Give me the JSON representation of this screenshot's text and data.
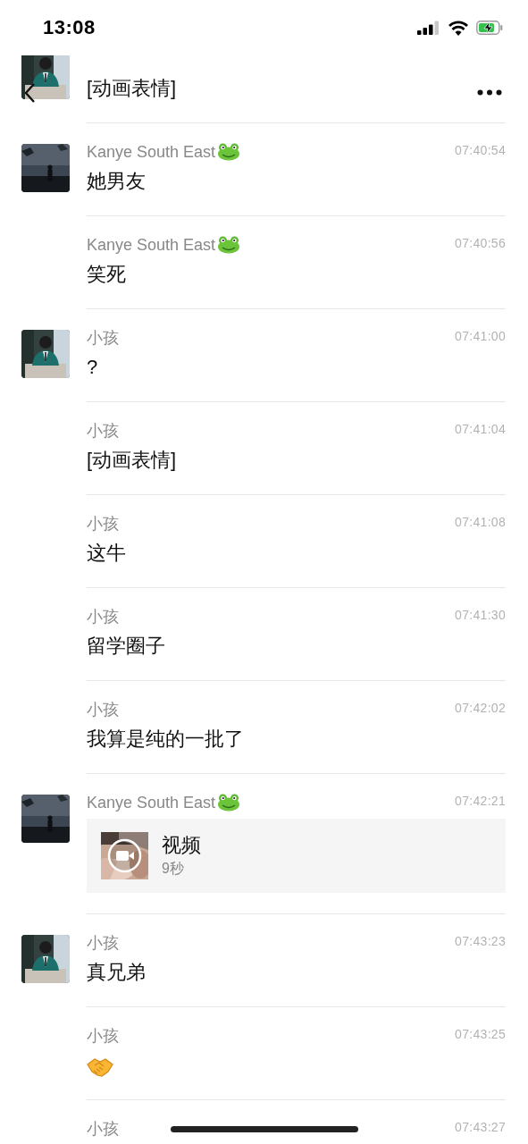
{
  "status_bar": {
    "time": "13:08"
  },
  "messages": [
    {
      "avatar": {
        "kind": "portrait"
      },
      "kind": "text",
      "text": "[动画表情]"
    },
    {
      "avatar": {
        "kind": "night"
      },
      "name": "Kanye South East",
      "name_icon": {
        "kind": "frog"
      },
      "time": "07:40:54",
      "kind": "text",
      "text": "她男友"
    },
    {
      "name": "Kanye South East",
      "name_icon": {
        "kind": "frog"
      },
      "time": "07:40:56",
      "kind": "text",
      "text": "笑死"
    },
    {
      "avatar": {
        "kind": "portrait"
      },
      "name": "小孩",
      "time": "07:41:00",
      "kind": "text",
      "text": "?"
    },
    {
      "name": "小孩",
      "time": "07:41:04",
      "kind": "text",
      "text": "[动画表情]"
    },
    {
      "name": "小孩",
      "time": "07:41:08",
      "kind": "text",
      "text": "这牛"
    },
    {
      "name": "小孩",
      "time": "07:41:30",
      "kind": "text",
      "text": "留学圈子"
    },
    {
      "name": "小孩",
      "time": "07:42:02",
      "kind": "text",
      "text": "我算是纯的一批了"
    },
    {
      "avatar": {
        "kind": "night"
      },
      "name": "Kanye South East",
      "name_icon": {
        "kind": "frog"
      },
      "time": "07:42:21",
      "kind": "video",
      "title": "视频",
      "duration": "9秒"
    },
    {
      "avatar": {
        "kind": "portrait"
      },
      "name": "小孩",
      "time": "07:43:23",
      "kind": "text",
      "text": "真兄弟"
    },
    {
      "name": "小孩",
      "time": "07:43:25",
      "kind": "emoji",
      "emoji": {
        "kind": "handshake"
      }
    },
    {
      "name": "小孩",
      "time": "07:43:27",
      "kind": "cut"
    }
  ]
}
